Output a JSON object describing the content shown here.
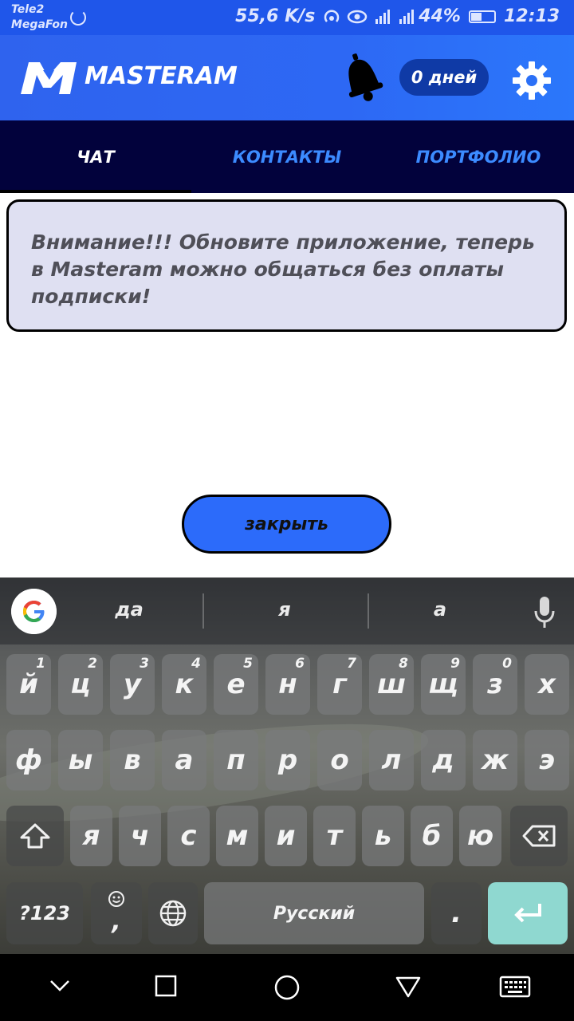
{
  "status_bar": {
    "carrier1": "Tele2",
    "carrier2": "MegaFon",
    "speed": "55,6 K/s",
    "battery": "44%",
    "time": "12:13"
  },
  "app_bar": {
    "brand": "MASTERAM",
    "days_badge": "0 дней",
    "brand_color": "#2d68f4"
  },
  "tabs": [
    {
      "label": "ЧАТ",
      "active": true
    },
    {
      "label": "КОНТАКТЫ",
      "active": false
    },
    {
      "label": "ПОРТФОЛИО",
      "active": false
    }
  ],
  "notice": {
    "text": "Внимание!!! Обновите приложение, теперь в Masteram можно общаться без оплаты подписки!"
  },
  "close_button": {
    "label": "закрыть"
  },
  "keyboard": {
    "suggestions": [
      "да",
      "я",
      "а"
    ],
    "row1": [
      {
        "k": "й",
        "h": "1"
      },
      {
        "k": "ц",
        "h": "2"
      },
      {
        "k": "у",
        "h": "3"
      },
      {
        "k": "к",
        "h": "4"
      },
      {
        "k": "е",
        "h": "5"
      },
      {
        "k": "н",
        "h": "6"
      },
      {
        "k": "г",
        "h": "7"
      },
      {
        "k": "ш",
        "h": "8"
      },
      {
        "k": "щ",
        "h": "9"
      },
      {
        "k": "з",
        "h": "0"
      },
      {
        "k": "х",
        "h": ""
      }
    ],
    "row2": [
      "ф",
      "ы",
      "в",
      "а",
      "п",
      "р",
      "о",
      "л",
      "д",
      "ж",
      "э"
    ],
    "row3": [
      "я",
      "ч",
      "с",
      "м",
      "и",
      "т",
      "ь",
      "б",
      "ю"
    ],
    "symbols_label": "?123",
    "comma": ",",
    "space_label": "Русский",
    "period": "."
  }
}
